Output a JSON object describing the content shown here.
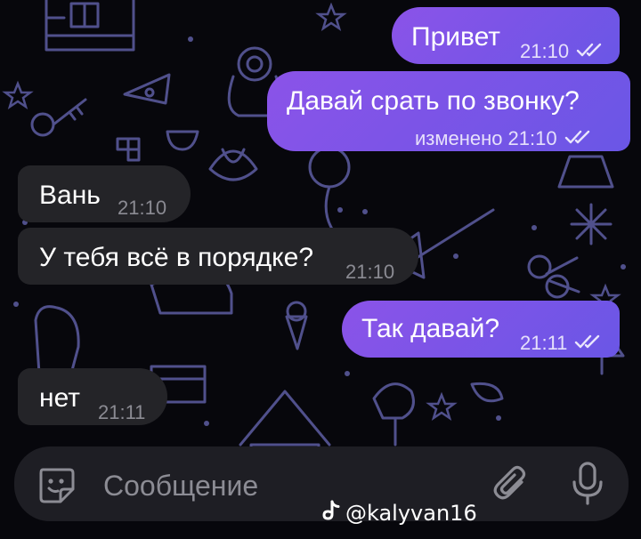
{
  "messages": [
    {
      "direction": "out",
      "text": "Привет",
      "time": "21:10",
      "status": "read"
    },
    {
      "direction": "out",
      "text": "Давай срать по звонку?",
      "edited_label": "изменено",
      "time": "21:10",
      "status": "read"
    },
    {
      "direction": "in",
      "text": "Вань",
      "time": "21:10"
    },
    {
      "direction": "in",
      "text": "У тебя всё в порядке?",
      "time": "21:10"
    },
    {
      "direction": "out",
      "text": "Так давай?",
      "time": "21:11",
      "status": "read"
    },
    {
      "direction": "in",
      "text": "нет",
      "time": "21:11"
    }
  ],
  "composer": {
    "placeholder": "Сообщение",
    "sticker_icon": "sticker-icon",
    "attach_icon": "paperclip-icon",
    "mic_icon": "microphone-icon"
  },
  "watermark": {
    "icon": "tiktok-icon",
    "text": "@kalyvan16"
  },
  "colors": {
    "background": "#07070c",
    "outgoing_bubble": "#7b55e8",
    "incoming_bubble": "#242428",
    "doodle": "#5a5a9a",
    "composer": "#1e1e24"
  }
}
